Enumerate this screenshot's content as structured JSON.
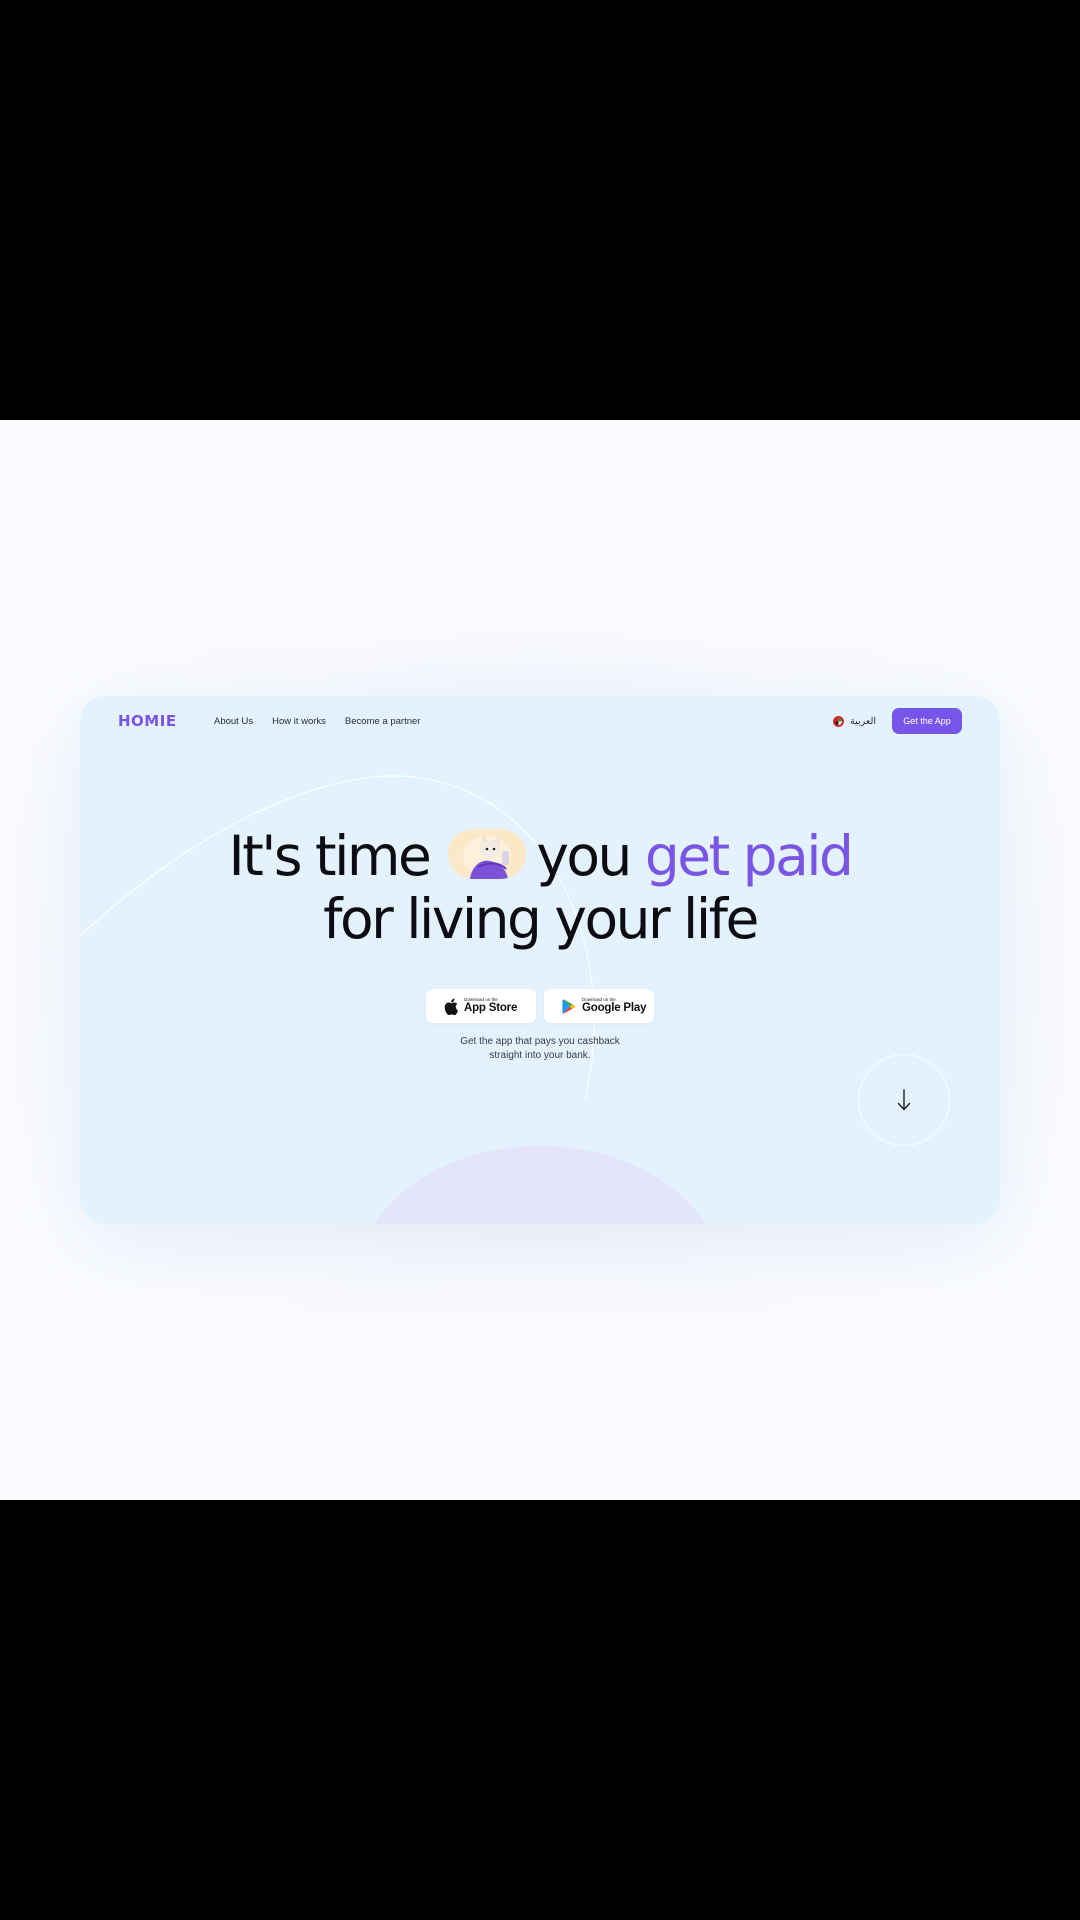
{
  "brand": {
    "logo_text": "HOMIE",
    "accent_color": "#7855ea",
    "card_background": "#e3f2fc"
  },
  "nav": {
    "links": [
      "About Us",
      "How it works",
      "Become a partner"
    ],
    "language_label": "العربية",
    "language_icon": "uae-flag-icon",
    "cta_label": "Get the App"
  },
  "hero": {
    "line1_part1": "It's time",
    "line1_part2": "you",
    "line1_accent": "get paid",
    "line2": "for living your life",
    "mascot_icon": "mascot-illustration"
  },
  "stores": {
    "apple": {
      "small": "Download on the",
      "big": "App Store",
      "icon": "apple-icon"
    },
    "google": {
      "small": "Download on the",
      "big": "Google Play",
      "icon": "google-play-icon"
    }
  },
  "tagline": {
    "line1": "Get the app that pays you cashback",
    "line2": "straight into your bank."
  },
  "scroll": {
    "icon": "arrow-down-icon"
  }
}
